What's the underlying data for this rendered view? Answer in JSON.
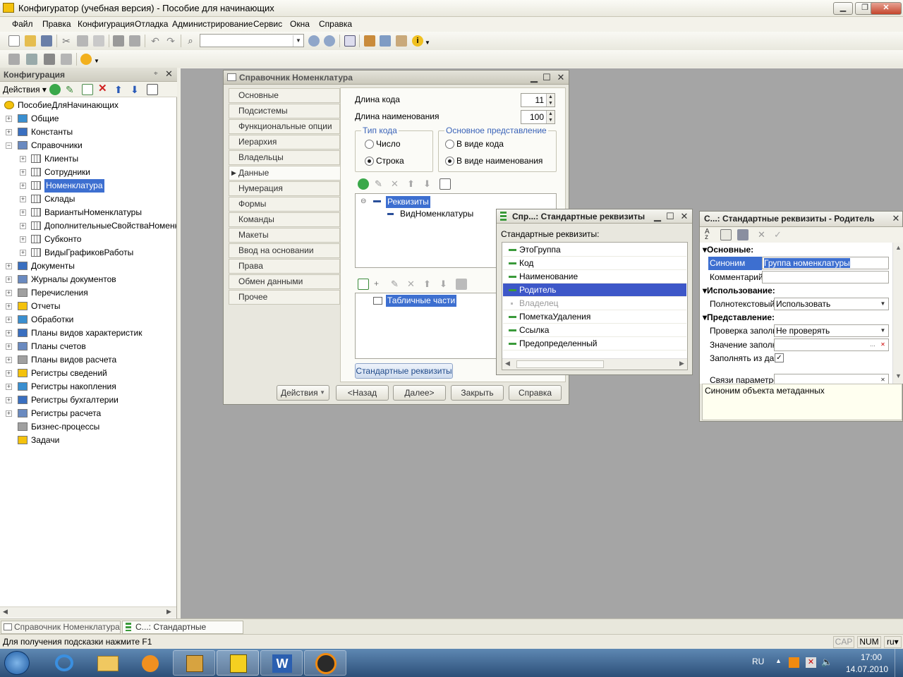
{
  "app": {
    "title": "Конфигуратор (учебная версия) - Пособие для начинающих"
  },
  "menu": [
    "Файл",
    "Правка",
    "Конфигурация",
    "Отладка",
    "Администрирование",
    "Сервис",
    "Окна",
    "Справка"
  ],
  "config_panel": {
    "title": "Конфигурация",
    "actions_label": "Действия",
    "tree": [
      {
        "label": "ПособиеДляНачинающих",
        "level": 0
      },
      {
        "label": "Общие",
        "level": 1
      },
      {
        "label": "Константы",
        "level": 1
      },
      {
        "label": "Справочники",
        "level": 1
      },
      {
        "label": "Клиенты",
        "level": 2
      },
      {
        "label": "Сотрудники",
        "level": 2
      },
      {
        "label": "Номенклатура",
        "level": 2
      },
      {
        "label": "Склады",
        "level": 2
      },
      {
        "label": "ВариантыНоменклатуры",
        "level": 2
      },
      {
        "label": "ДополнительныеСвойстваНоменкла",
        "level": 2
      },
      {
        "label": "Субконто",
        "level": 2
      },
      {
        "label": "ВидыГрафиковРаботы",
        "level": 2
      },
      {
        "label": "Документы",
        "level": 1
      },
      {
        "label": "Журналы документов",
        "level": 1
      },
      {
        "label": "Перечисления",
        "level": 1
      },
      {
        "label": "Отчеты",
        "level": 1
      },
      {
        "label": "Обработки",
        "level": 1
      },
      {
        "label": "Планы видов характеристик",
        "level": 1
      },
      {
        "label": "Планы счетов",
        "level": 1
      },
      {
        "label": "Планы видов расчета",
        "level": 1
      },
      {
        "label": "Регистры сведений",
        "level": 1
      },
      {
        "label": "Регистры накопления",
        "level": 1
      },
      {
        "label": "Регистры бухгалтерии",
        "level": 1
      },
      {
        "label": "Регистры расчета",
        "level": 1
      },
      {
        "label": "Бизнес-процессы",
        "level": 1
      },
      {
        "label": "Задачи",
        "level": 1
      }
    ]
  },
  "catalog_window": {
    "title": "Справочник Номенклатура",
    "nav": [
      "Основные",
      "Подсистемы",
      "Функциональные опции",
      "Иерархия",
      "Владельцы",
      "Данные",
      "Нумерация",
      "Формы",
      "Команды",
      "Макеты",
      "Ввод на основании",
      "Права",
      "Обмен данными",
      "Прочее"
    ],
    "active_nav": "Данные",
    "code_length_label": "Длина кода",
    "code_length": "11",
    "name_length_label": "Длина наименования",
    "name_length": "100",
    "code_type": {
      "legend": "Тип кода",
      "options": [
        "Число",
        "Строка"
      ],
      "selected": "Строка"
    },
    "main_repr": {
      "legend": "Основное представление",
      "options": [
        "В виде кода",
        "В виде наименования"
      ],
      "selected": "В виде наименования"
    },
    "attributes_root": "Реквизиты",
    "attribute_child": "ВидНоменклатуры",
    "tabular_root": "Табличные части",
    "std_attrs_button": "Стандартные реквизиты",
    "buttons": {
      "actions": "Действия",
      "back": "<Назад",
      "next": "Далее>",
      "close": "Закрыть",
      "help": "Справка"
    }
  },
  "std_window": {
    "title": "Спр...: Стандартные реквизиты",
    "subtitle": "Стандартные реквизиты:",
    "items": [
      "ЭтоГруппа",
      "Код",
      "Наименование",
      "Родитель",
      "Владелец",
      "ПометкаУдаления",
      "Ссылка",
      "Предопределенный"
    ],
    "selected": "Родитель",
    "disabled": "Владелец"
  },
  "props_window": {
    "title": "С...: Стандартные реквизиты - Родитель",
    "sections": {
      "basic": "Основные:",
      "usage": "Использование:",
      "presentation": "Представление:"
    },
    "synonym_label": "Синоним",
    "synonym_value": "Группа номенклатуры",
    "comment_label": "Комментарий",
    "fulltext_label": "Полнотекстовый",
    "fulltext_value": "Использовать",
    "fillcheck_label": "Проверка заполн",
    "fillcheck_value": "Не проверять",
    "fillvalue_label": "Значение заполн",
    "fillfrom_label": "Заполнять из дан",
    "links_label": "Связи параметро",
    "description": "Синоним объекта метаданных"
  },
  "window_tabs": [
    "Справочник Номенклатура",
    "С...: Стандартные реквизиты"
  ],
  "status": {
    "hint": "Для получения подсказки нажмите F1",
    "cap": "CAP",
    "num": "NUM",
    "lang": "ru"
  },
  "taskbar": {
    "lang": "RU",
    "time": "17:00",
    "date": "14.07.2010"
  },
  "colors": {
    "accent": "#3d6fd0",
    "group_label": "#3a63b8"
  }
}
